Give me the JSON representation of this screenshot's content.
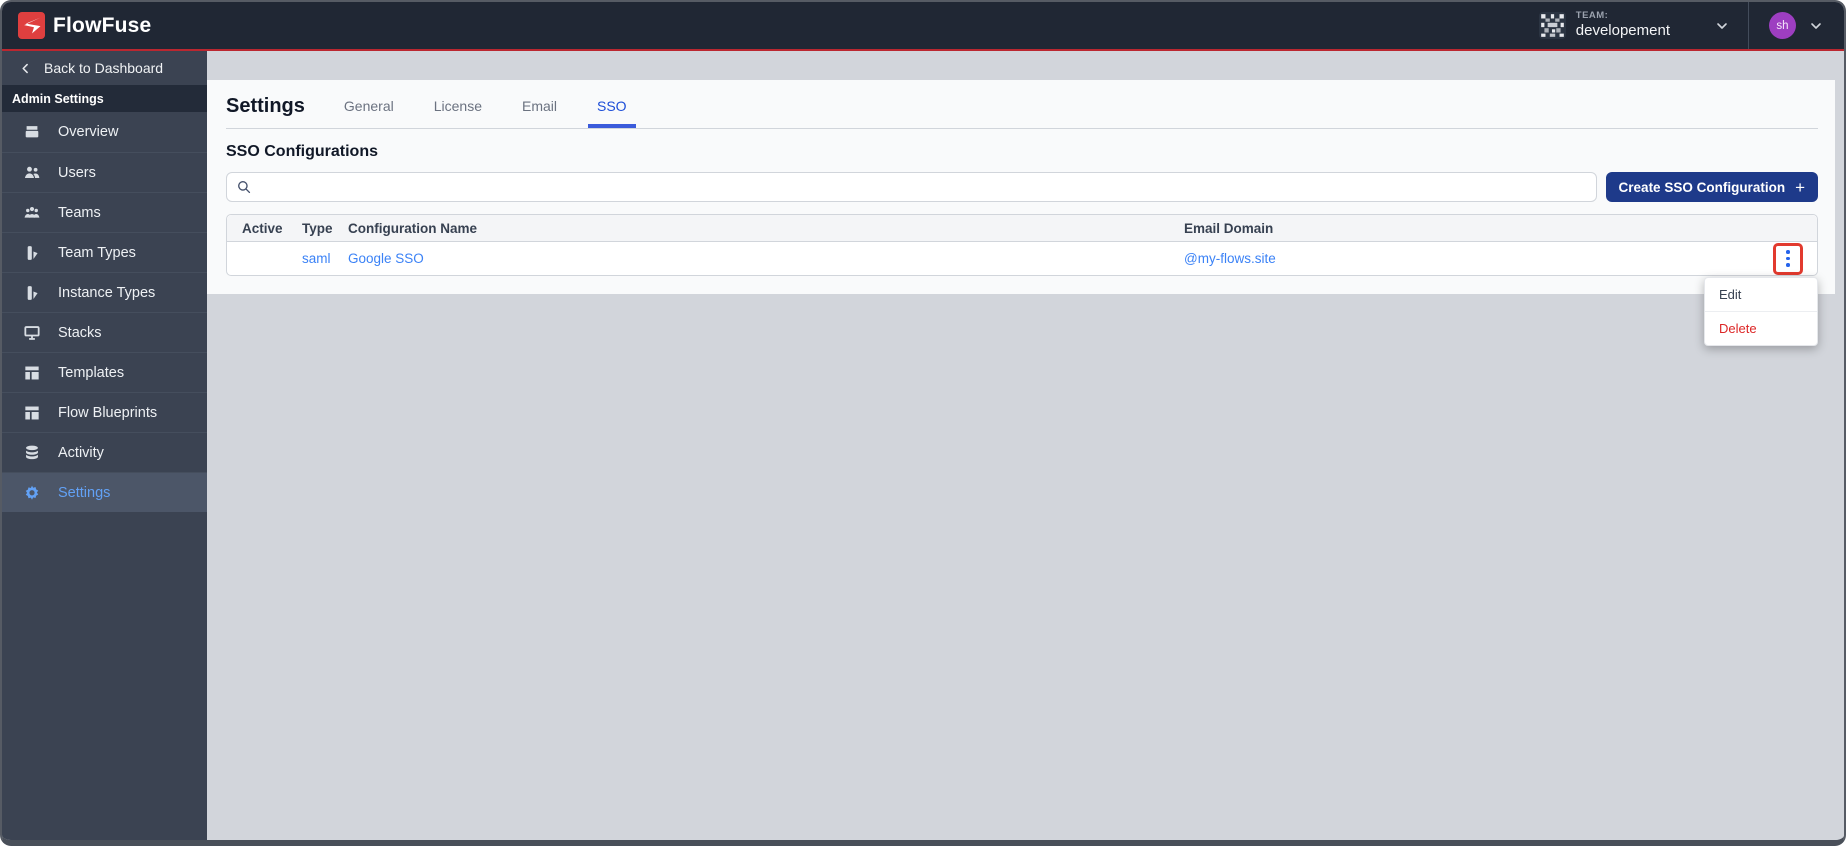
{
  "brand": {
    "name": "FlowFuse"
  },
  "navbar": {
    "team_label": "TEAM:",
    "team_name": "developement",
    "user_initials": "sh"
  },
  "sidebar": {
    "back_label": "Back to Dashboard",
    "section_label": "Admin Settings",
    "items": [
      {
        "label": "Overview",
        "icon": "overview-icon",
        "active": false
      },
      {
        "label": "Users",
        "icon": "users-icon",
        "active": false
      },
      {
        "label": "Teams",
        "icon": "teams-icon",
        "active": false
      },
      {
        "label": "Team Types",
        "icon": "team-types-icon",
        "active": false
      },
      {
        "label": "Instance Types",
        "icon": "instance-types-icon",
        "active": false
      },
      {
        "label": "Stacks",
        "icon": "stacks-icon",
        "active": false
      },
      {
        "label": "Templates",
        "icon": "templates-icon",
        "active": false
      },
      {
        "label": "Flow Blueprints",
        "icon": "blueprints-icon",
        "active": false
      },
      {
        "label": "Activity",
        "icon": "activity-icon",
        "active": false
      },
      {
        "label": "Settings",
        "icon": "settings-gear-icon",
        "active": true
      }
    ]
  },
  "main": {
    "title": "Settings",
    "tabs": [
      {
        "label": "General",
        "active": false
      },
      {
        "label": "License",
        "active": false
      },
      {
        "label": "Email",
        "active": false
      },
      {
        "label": "SSO",
        "active": true
      }
    ],
    "section_title": "SSO Configurations",
    "search": {
      "placeholder": ""
    },
    "create_button": {
      "label": "Create SSO Configuration",
      "icon": "+"
    },
    "table": {
      "columns": [
        "Active",
        "Type",
        "Configuration Name",
        "Email Domain"
      ],
      "rows": [
        {
          "active": "",
          "type": "saml",
          "name": "Google SSO",
          "email_domain": "@my-flows.site"
        }
      ]
    },
    "context_menu": {
      "items": [
        {
          "label": "Edit",
          "danger": false
        },
        {
          "label": "Delete",
          "danger": true
        }
      ]
    }
  },
  "colors": {
    "brand_red": "#bb2730",
    "link_blue": "#3b82f6",
    "active_tab_blue": "#1d4ed8",
    "button_navy": "#1e3a8a",
    "danger_red": "#dc2626",
    "highlight_outline_red": "#e23a2e",
    "avatar_purple": "#9d3ec1"
  }
}
